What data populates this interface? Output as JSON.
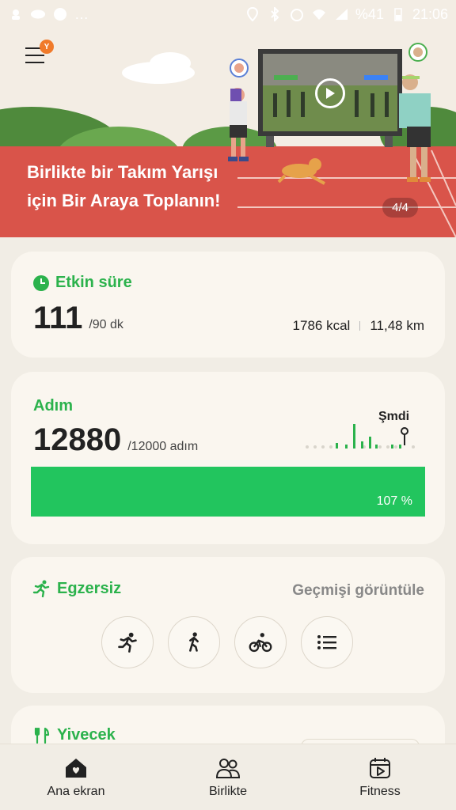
{
  "status_bar": {
    "battery": "%41",
    "time": "21:06"
  },
  "header": {
    "menu_badge": "Y"
  },
  "hero": {
    "title_line1": "Birlikte bir Takım Yarışı",
    "title_line2": "için Bir Araya Toplanın!",
    "page_indicator": "4/4"
  },
  "active_time": {
    "title": "Etkin süre",
    "value": "111",
    "goal": "/90 dk",
    "calories": "1786 kcal",
    "distance": "11,48 km"
  },
  "steps": {
    "title": "Adım",
    "value": "12880",
    "goal": "/12000 adım",
    "now_label": "Şmdi",
    "progress_label": "107 %",
    "progress_fraction": 1.0
  },
  "exercise": {
    "title": "Egzersiz",
    "history_link": "Geçmişi görüntüle",
    "buttons": [
      "running-icon",
      "walking-icon",
      "cycling-icon",
      "list-icon"
    ]
  },
  "food": {
    "title": "Yivecek"
  },
  "bottom_nav": {
    "items": [
      {
        "label": "Ana ekran",
        "icon": "home-heart-icon"
      },
      {
        "label": "Birlikte",
        "icon": "people-icon"
      },
      {
        "label": "Fitness",
        "icon": "play-calendar-icon"
      }
    ]
  },
  "colors": {
    "accent_green": "#2bb24c",
    "progress_green": "#22c55e",
    "track_red": "#d9544a",
    "badge_orange": "#f07a2a"
  }
}
